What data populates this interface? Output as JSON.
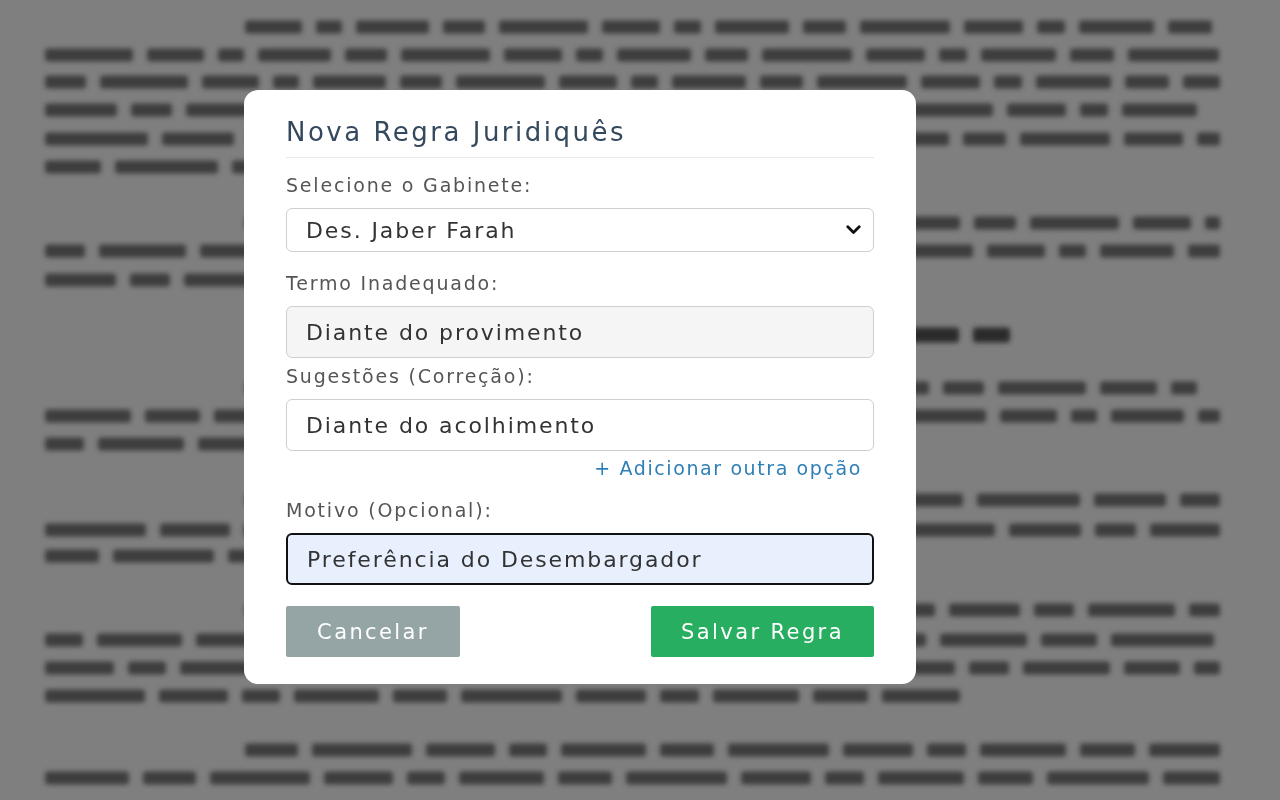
{
  "dialog": {
    "title": "Nova Regra Juridiquês",
    "fields": [
      {
        "kind": "select",
        "label": "Selecione o Gabinete:",
        "value": "Des. Jaber Farah",
        "focused": false
      },
      {
        "kind": "readonly",
        "label": "Termo Inadequado:",
        "value": "Diante do provimento",
        "focused": false
      },
      {
        "kind": "text",
        "label": "Sugestões (Correção):",
        "value": "Diante do acolhimento",
        "focused": false,
        "link": "+ Adicionar outra opção"
      },
      {
        "kind": "text",
        "label": "Motivo (Opcional):",
        "value": "Preferência do Desembargador",
        "focused": true
      }
    ],
    "buttons": [
      {
        "kind": "secondary",
        "label": "Cancelar"
      },
      {
        "kind": "primary",
        "label": "Salvar Regra"
      }
    ]
  }
}
